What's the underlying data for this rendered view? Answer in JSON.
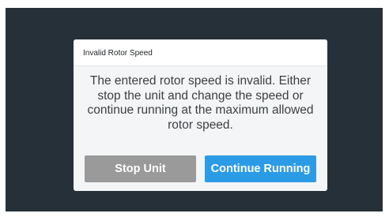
{
  "dialog": {
    "title": "Invalid Rotor Speed",
    "message": "The entered rotor speed is invalid. Either stop the unit and change the speed or continue running at the maximum allowed rotor speed.",
    "buttons": {
      "stop_label": "Stop Unit",
      "continue_label": "Continue Running"
    }
  },
  "colors": {
    "background": "#263038",
    "dialog_body": "#f3f5f6",
    "stop_button": "#9a9a9a",
    "continue_button": "#2c9be6"
  }
}
